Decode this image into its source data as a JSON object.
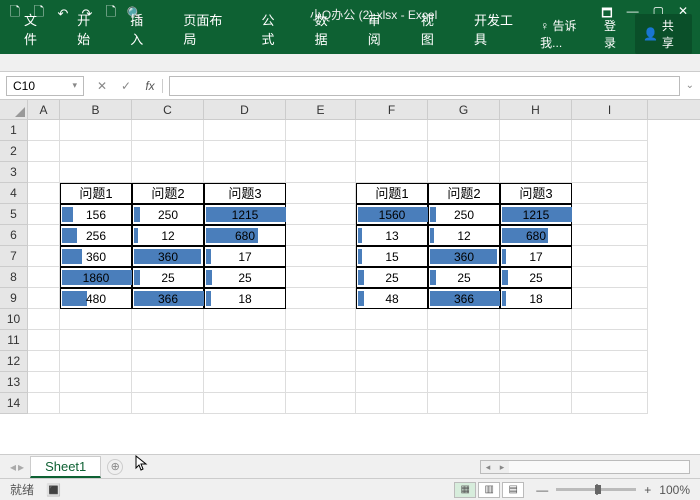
{
  "title": "小Q办公 (2).xlsx - Excel",
  "qat": [
    "🗋",
    "🗋",
    "↶",
    "↷",
    "🗋",
    "🔍"
  ],
  "winbtns": [
    "🗖",
    "—",
    "▢",
    "✕"
  ],
  "tabs": [
    "文件",
    "开始",
    "插入",
    "页面布局",
    "公式",
    "数据",
    "审阅",
    "视图",
    "开发工具"
  ],
  "tell_me": "♀ 告诉我...",
  "login": "登录",
  "share": "共享",
  "namebox": "C10",
  "fx": "fx",
  "cols": [
    "A",
    "B",
    "C",
    "D",
    "E",
    "F",
    "G",
    "H",
    "I"
  ],
  "rownums": [
    "1",
    "2",
    "3",
    "4",
    "5",
    "6",
    "7",
    "8",
    "9",
    "10",
    "11",
    "12",
    "13",
    "14"
  ],
  "h": [
    "问题1",
    "问题2",
    "问题3"
  ],
  "t1": [
    {
      "v": [
        "156",
        "250",
        "1215"
      ],
      "w": [
        0.15,
        0.08,
        1.0
      ]
    },
    {
      "v": [
        "256",
        "12",
        "680"
      ],
      "w": [
        0.22,
        0.06,
        0.65
      ]
    },
    {
      "v": [
        "360",
        "360",
        "17"
      ],
      "w": [
        0.28,
        0.95,
        0.06
      ]
    },
    {
      "v": [
        "1860",
        "25",
        "25"
      ],
      "w": [
        1.0,
        0.08,
        0.08
      ]
    },
    {
      "v": [
        "480",
        "366",
        "18"
      ],
      "w": [
        0.35,
        1.0,
        0.06
      ]
    }
  ],
  "t2": [
    {
      "v": [
        "1560",
        "250",
        "1215"
      ],
      "w": [
        1.0,
        0.08,
        1.0
      ]
    },
    {
      "v": [
        "13",
        "12",
        "680"
      ],
      "w": [
        0.06,
        0.06,
        0.65
      ]
    },
    {
      "v": [
        "15",
        "360",
        "17"
      ],
      "w": [
        0.06,
        0.95,
        0.06
      ]
    },
    {
      "v": [
        "25",
        "25",
        "25"
      ],
      "w": [
        0.08,
        0.08,
        0.08
      ]
    },
    {
      "v": [
        "48",
        "366",
        "18"
      ],
      "w": [
        0.09,
        1.0,
        0.06
      ]
    }
  ],
  "sheet": "Sheet1",
  "add": "⊕",
  "status": "就绪",
  "rec": "🔳",
  "zoom": "100%",
  "minus": "—",
  "plus": "+",
  "chart_data": {
    "type": "table",
    "note": "two tables with in-cell data bars (per-column conditional formatting)",
    "table1": {
      "headers": [
        "问题1",
        "问题2",
        "问题3"
      ],
      "rows": [
        [
          156,
          250,
          1215
        ],
        [
          256,
          12,
          680
        ],
        [
          360,
          360,
          17
        ],
        [
          1860,
          25,
          25
        ],
        [
          480,
          366,
          18
        ]
      ]
    },
    "table2": {
      "headers": [
        "问题1",
        "问题2",
        "问题3"
      ],
      "rows": [
        [
          1560,
          250,
          1215
        ],
        [
          13,
          12,
          680
        ],
        [
          15,
          360,
          17
        ],
        [
          25,
          25,
          25
        ],
        [
          48,
          366,
          18
        ]
      ]
    }
  }
}
